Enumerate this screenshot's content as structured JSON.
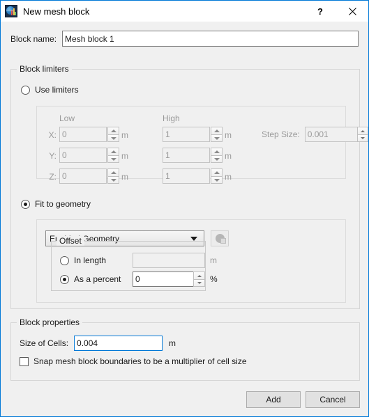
{
  "window": {
    "title": "New mesh block",
    "icon": "mesh-globe-icon",
    "help_label": "?",
    "close_label": "✕",
    "accent_color": "#0078d7",
    "background_color": "#f0f0f0"
  },
  "block_name": {
    "label": "Block name:",
    "value": "Mesh block 1"
  },
  "block_limiters": {
    "legend": "Block limiters",
    "use_limiters": {
      "label": "Use limiters",
      "selected": false
    },
    "columns": {
      "low": "Low",
      "high": "High"
    },
    "unit": "m",
    "rows": [
      {
        "axis": "X:",
        "low": "0",
        "high": "1"
      },
      {
        "axis": "Y:",
        "low": "0",
        "high": "1"
      },
      {
        "axis": "Z:",
        "low": "0",
        "high": "1"
      }
    ],
    "step_size": {
      "label": "Step Size:",
      "value": "0.001"
    },
    "fit_to_geometry": {
      "label": "Fit to geometry",
      "selected": true,
      "geometry_select": {
        "value": "Enabled Geometry",
        "options": [
          "Enabled Geometry"
        ]
      },
      "geometry_button_icon": "geometry-pick-icon",
      "offset": {
        "legend": "Offset",
        "in_length": {
          "label": "In length",
          "selected": false,
          "value": "",
          "unit": "m"
        },
        "as_percent": {
          "label": "As a percent",
          "selected": true,
          "value": "0",
          "unit": "%"
        }
      }
    }
  },
  "block_properties": {
    "legend": "Block properties",
    "size_of_cells": {
      "label": "Size of Cells:",
      "value": "0.004",
      "unit": "m"
    },
    "snap_checkbox": {
      "label": "Snap mesh block boundaries to be a multiplier of cell size",
      "checked": false
    }
  },
  "footer": {
    "add_label": "Add",
    "cancel_label": "Cancel"
  }
}
